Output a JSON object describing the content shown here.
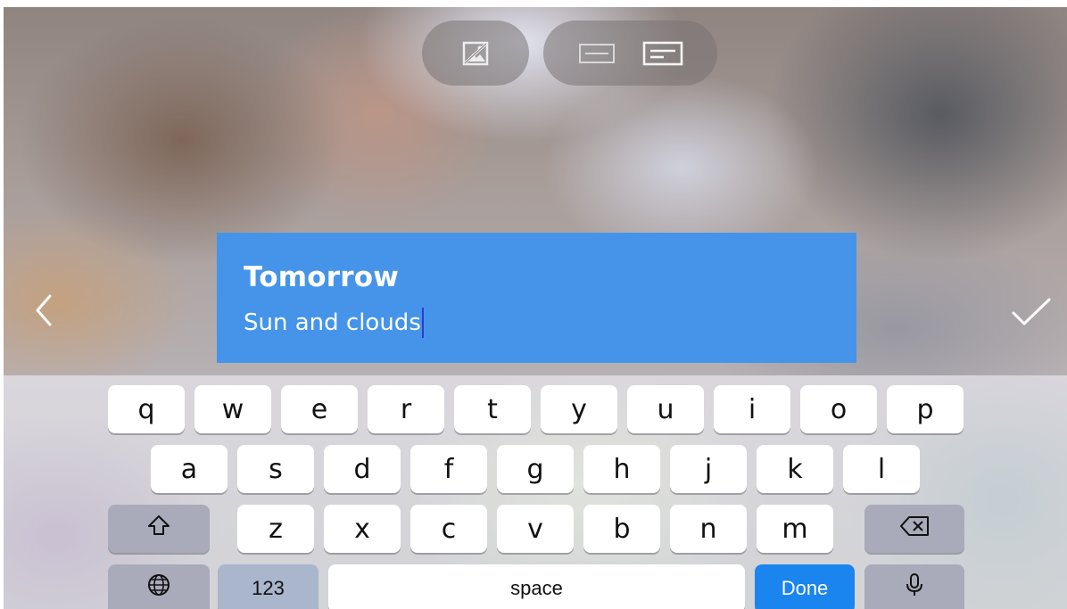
{
  "toolbar": {
    "left_icons": [
      "no-photo-icon"
    ],
    "right_icons": [
      "title-only-layout-icon",
      "title-subtitle-layout-icon"
    ]
  },
  "nav": {
    "back_icon": "chevron-left-icon",
    "confirm_icon": "checkmark-icon"
  },
  "card": {
    "title": "Tomorrow",
    "subtitle": "Sun and clouds",
    "background": "#4594ea"
  },
  "keyboard": {
    "row1": [
      "q",
      "w",
      "e",
      "r",
      "t",
      "y",
      "u",
      "i",
      "o",
      "p"
    ],
    "row2": [
      "a",
      "s",
      "d",
      "f",
      "g",
      "h",
      "j",
      "k",
      "l"
    ],
    "row3": [
      "z",
      "x",
      "c",
      "v",
      "b",
      "n",
      "m"
    ],
    "shift_icon": "shift-icon",
    "backspace_icon": "backspace-icon",
    "globe_icon": "globe-icon",
    "mic_icon": "microphone-icon",
    "numbers_label": "123",
    "space_label": "space",
    "done_label": "Done",
    "done_color": "#1a84ef"
  }
}
